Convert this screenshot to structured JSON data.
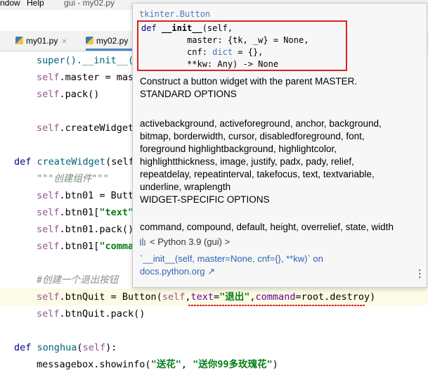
{
  "menubar": {
    "window_label": "ndow",
    "help_label": "Help",
    "title": "gui - my02.py"
  },
  "tabs": [
    {
      "label": "my01.py",
      "close": "×"
    },
    {
      "label": "my02.py",
      "close": "×"
    }
  ],
  "code": {
    "l1_a": "super().__init__(",
    "l2_self": "self",
    "l2_rest": ".master = mas",
    "l3_self": "self",
    "l3_rest": ".pack()",
    "l4_self": "self",
    "l4_rest": ".createWidget",
    "l5_def": "def ",
    "l5_name": "createWidget",
    "l5_rest": "(self",
    "l6_doc": "\"\"\"创建组件\"\"\"",
    "l7_self": "self",
    "l7_rest": ".btn01 = Butt",
    "l8_self": "self",
    "l8_rest": ".btn01[",
    "l8_str": "\"text\"",
    "l9_self": "self",
    "l9_rest": ".btn01.pack()",
    "l10_self": "self",
    "l10_rest": ".btn01[",
    "l10_str": "\"comma",
    "l11_com": "#创建一个退出按钮",
    "l12_self": "self",
    "l12_a": ".btnQuit = Button(",
    "l12_self2": "self",
    "l12_b": ",",
    "l12_text": "text",
    "l12_eq": "=",
    "l12_str": "\"退出\"",
    "l12_c": ",",
    "l12_cmd": "command",
    "l12_d": "=root.destroy)",
    "l13_self": "self",
    "l13_rest": ".btnQuit.pack()",
    "l14_def": "def ",
    "l14_name": "songhua",
    "l14_rest": "(",
    "l14_self": "self",
    "l14_end": "):",
    "l15_a": "messagebox.showinfo(",
    "l15_s1": "\"送花\"",
    "l15_b": ", ",
    "l15_s2": "\"送你99多玫瑰花\"",
    "l15_c": ")"
  },
  "popup": {
    "qualifier": "tkinter.Button",
    "sig1_def": "def ",
    "sig1_name": "__init__",
    "sig1_rest": "(self,",
    "sig2": "         master: {tk, _w} = None,",
    "sig3_a": "         cnf: ",
    "sig3_dict": "dict",
    "sig3_b": " = {},",
    "sig4": "         **kw: Any) -> None",
    "desc": [
      "Construct a button widget with the parent MASTER.",
      "STANDARD OPTIONS",
      "",
      "activebackground, activeforeground, anchor, background,",
      "bitmap, borderwidth, cursor, disabledforeground, font,",
      "foreground highlightbackground, highlightcolor,",
      "highlightthickness, image, justify, padx, pady, relief,",
      "repeatdelay, repeatinterval, takefocus, text, textvariable,",
      "underline, wraplength",
      "WIDGET-SPECIFIC OPTIONS",
      "",
      "command, compound, default, height, overrelief, state, width"
    ],
    "python_label": "< Python 3.9 (gui) >",
    "link1": "`__init__(self, master=None, cnf={}, **kw)` on",
    "link2": "docs.python.org ↗",
    "more_icon": "more-vertical-icon"
  },
  "colors": {
    "accent": "#4a86c7",
    "keyword": "#00008b",
    "self": "#94558d",
    "string": "#067d17",
    "error": "#e02020"
  }
}
